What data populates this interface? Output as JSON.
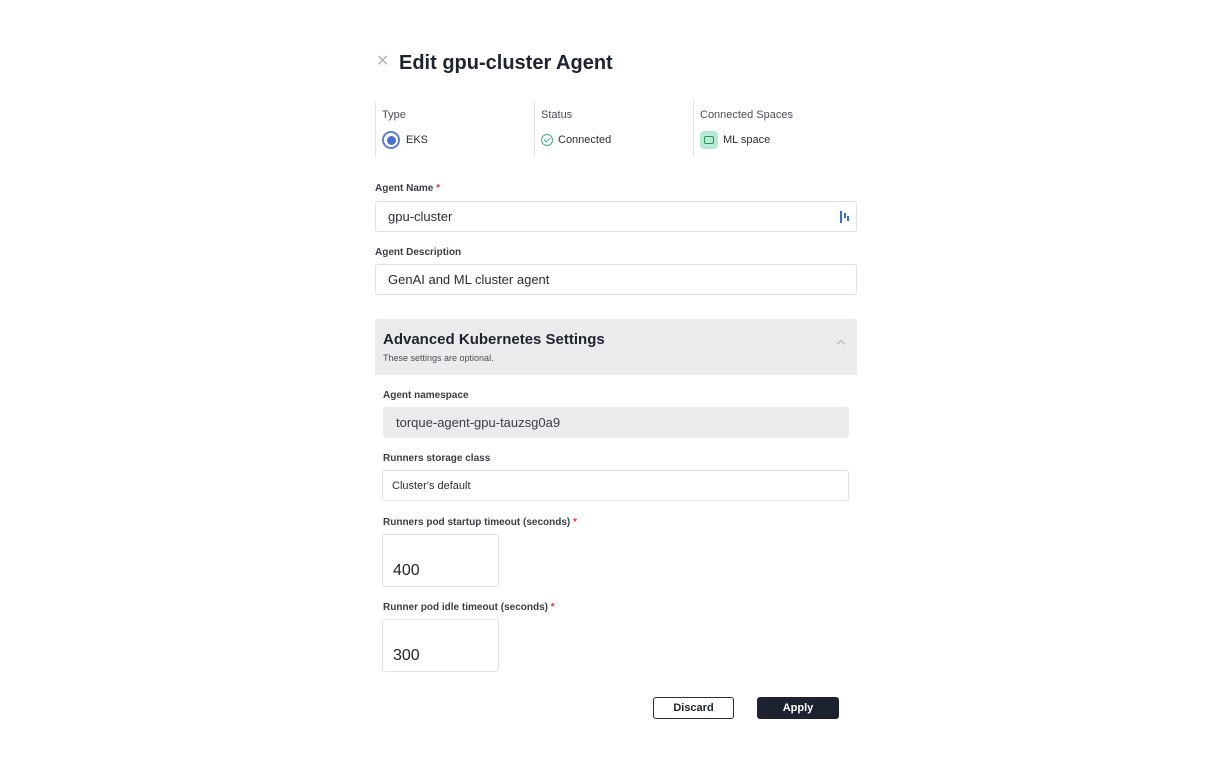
{
  "dialog": {
    "title": "Edit gpu-cluster Agent",
    "close_icon": "close-icon"
  },
  "info": {
    "type_label": "Type",
    "type_value": "EKS",
    "status_label": "Status",
    "status_value": "Connected",
    "spaces_label": "Connected Spaces",
    "spaces_value": "ML space"
  },
  "form": {
    "agent_name_label": "Agent Name",
    "agent_name_value": "gpu-cluster",
    "agent_description_label": "Agent Description",
    "agent_description_value": "GenAI and ML cluster agent",
    "required_marker": "*"
  },
  "advanced": {
    "title": "Advanced Kubernetes Settings",
    "subtitle": "These settings are optional.",
    "namespace_label": "Agent namespace",
    "namespace_value": "torque-agent-gpu-tauzsg0a9",
    "storage_label": "Runners storage class",
    "storage_value": "Cluster's default",
    "startup_timeout_label": "Runners pod startup timeout (seconds)",
    "startup_timeout_value": "400",
    "idle_timeout_label": "Runner pod idle timeout (seconds)",
    "idle_timeout_value": "300"
  },
  "actions": {
    "discard_label": "Discard",
    "apply_label": "Apply"
  },
  "colors": {
    "accent_dark": "#1c2230",
    "required": "#e0353b",
    "connected": "#3fae83",
    "eks_blue": "#4a6fd1"
  }
}
